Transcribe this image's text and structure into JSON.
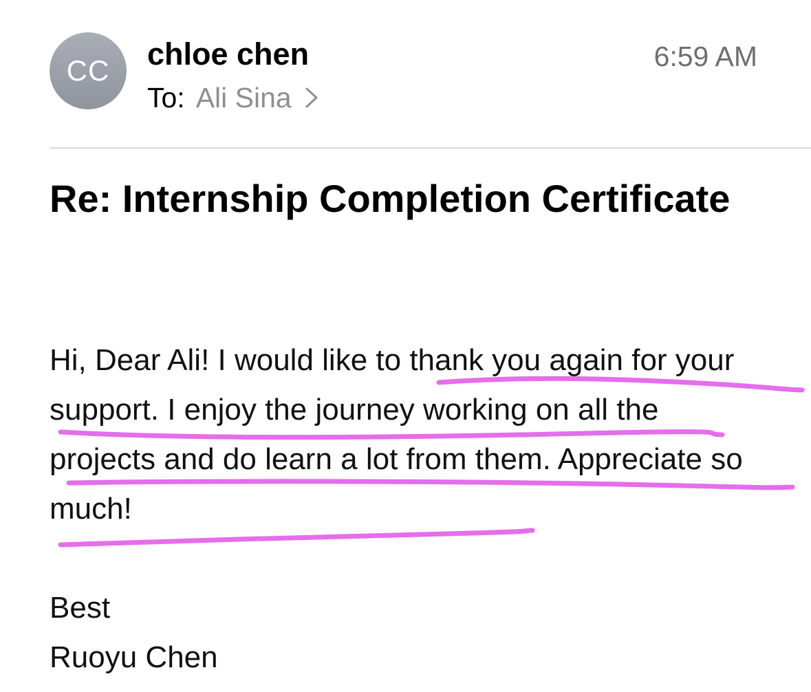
{
  "email": {
    "sender": {
      "initials": "CC",
      "name": "chloe chen"
    },
    "recipient": {
      "to_label": "To:",
      "name": "Ali Sina"
    },
    "timestamp": "6:59 AM",
    "subject": "Re: Internship Completion Certificate",
    "body": "Hi, Dear Ali! I would like to thank you again for your support. I enjoy the journey working on all the projects and do learn a lot from them. Appreciate so much!",
    "closing": "Best",
    "signature": "Ruoyu Chen"
  },
  "annotations": {
    "highlight_color": "#e055e8",
    "style": "hand-drawn underline"
  },
  "icons": {
    "recipient_chevron": "chevron-right-icon"
  },
  "colors": {
    "avatar_bg": "#9a9ea7",
    "secondary_text": "#8e8e93",
    "timestamp_text": "#6e6e73",
    "divider": "#d9d9dc"
  }
}
